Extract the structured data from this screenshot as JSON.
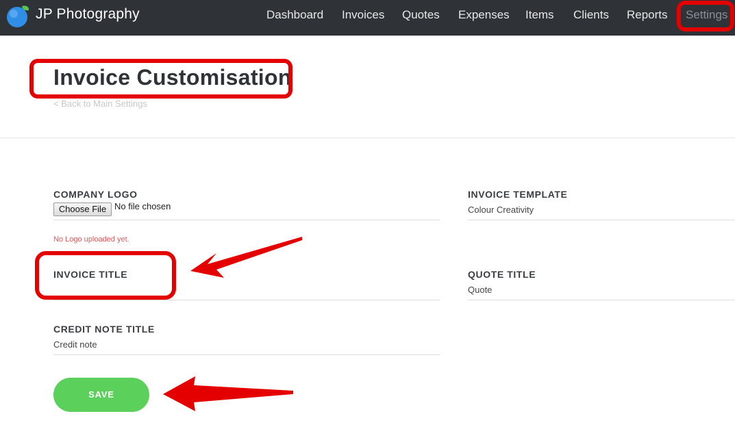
{
  "app": {
    "brand": "JP Photography"
  },
  "nav": {
    "items": [
      {
        "label": "Dashboard"
      },
      {
        "label": "Invoices"
      },
      {
        "label": "Quotes"
      },
      {
        "label": "Expenses"
      },
      {
        "label": "Items"
      },
      {
        "label": "Clients"
      },
      {
        "label": "Reports"
      },
      {
        "label": "Settings",
        "active": true
      }
    ]
  },
  "page": {
    "title": "Invoice Customisation",
    "back_link": "< Back to Main Settings"
  },
  "form": {
    "company_logo": {
      "label": "COMPANY LOGO",
      "button": "Choose File",
      "status": "No file chosen",
      "note": "No Logo uploaded yet."
    },
    "invoice_template": {
      "label": "INVOICE TEMPLATE",
      "value": "Colour Creativity"
    },
    "invoice_title": {
      "label": "INVOICE TITLE",
      "value": ""
    },
    "quote_title": {
      "label": "QUOTE TITLE",
      "value": "Quote"
    },
    "credit_note_title": {
      "label": "CREDIT NOTE TITLE",
      "value": "Credit note"
    },
    "save_label": "SAVE"
  },
  "colors": {
    "navbar": "#2f3237",
    "save": "#5bd05b",
    "annotation": "#e50000",
    "error_text": "#e05a5a"
  }
}
